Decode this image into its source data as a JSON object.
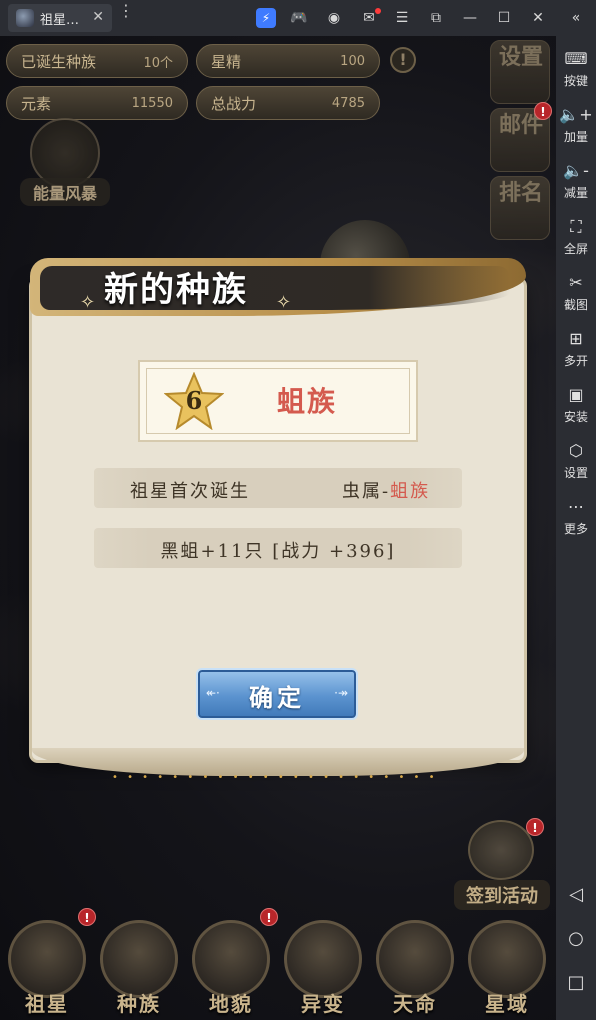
{
  "window": {
    "tab_title": "祖星…",
    "tab_close": "✕",
    "menu_glyph": "⋮",
    "controls": {
      "collapse": "«",
      "close": "✕",
      "maximize": "☐",
      "minimize": "—"
    }
  },
  "hud": {
    "born_races_label": "已诞生种族",
    "born_races_value": "10个",
    "star_essence_label": "星精",
    "star_essence_value": "100",
    "info_glyph": "!",
    "elements_label": "元素",
    "elements_value": "11550",
    "total_power_label": "总战力",
    "total_power_value": "4785"
  },
  "side_buttons": {
    "settings": "设置",
    "mail": "邮件",
    "rank": "排名",
    "badge_glyph": "!"
  },
  "energy_storm": {
    "label": "能量风暴"
  },
  "modal": {
    "title": "新的种族",
    "race_level": "6",
    "race_name": "蛆族",
    "first_birth_label": "祖星首次诞生",
    "category_prefix": "虫属-",
    "category_race": "蛆族",
    "reward_text": "黑蛆+11只 [战力 +396]",
    "confirm_label": "确定"
  },
  "sign_in": {
    "label": "签到活动"
  },
  "bottom_nav": [
    {
      "label": "祖星",
      "badge": "!"
    },
    {
      "label": "种族",
      "badge": ""
    },
    {
      "label": "地貌",
      "badge": "!"
    },
    {
      "label": "异变",
      "badge": ""
    },
    {
      "label": "天命",
      "badge": ""
    },
    {
      "label": "星域",
      "badge": ""
    }
  ],
  "sidebar": {
    "items": [
      {
        "label": "按键",
        "icon": "keyboard-icon",
        "glyph": "⌨"
      },
      {
        "label": "加量",
        "icon": "volume-up-icon",
        "glyph": "🔈+"
      },
      {
        "label": "减量",
        "icon": "volume-down-icon",
        "glyph": "🔈-"
      },
      {
        "label": "全屏",
        "icon": "fullscreen-icon",
        "glyph": "⛶"
      },
      {
        "label": "截图",
        "icon": "scissors-icon",
        "glyph": "✂"
      },
      {
        "label": "多开",
        "icon": "multi-instance-icon",
        "glyph": "⊞"
      },
      {
        "label": "安装",
        "icon": "apk-install-icon",
        "glyph": "▣"
      },
      {
        "label": "设置",
        "icon": "settings-icon",
        "glyph": "⬡"
      },
      {
        "label": "更多",
        "icon": "more-icon",
        "glyph": "⋯"
      }
    ],
    "nav": {
      "back": "◁",
      "home": "○",
      "recent": "□"
    }
  },
  "colors": {
    "accent_red": "#d45a4e",
    "confirm_blue": "#5b93cf",
    "gold": "#b88f4a",
    "parchment": "#e9e3d4"
  }
}
